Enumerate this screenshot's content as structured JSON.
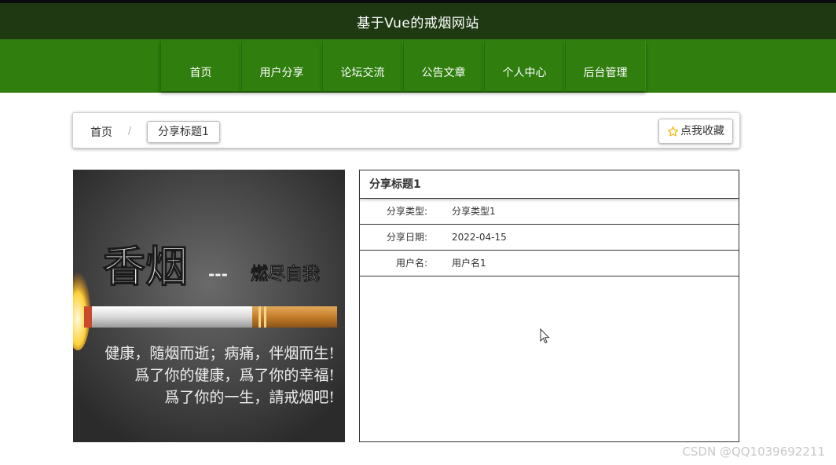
{
  "header": {
    "title": "基于Vue的戒烟网站"
  },
  "nav": {
    "items": [
      {
        "label": "首页"
      },
      {
        "label": "用户分享"
      },
      {
        "label": "论坛交流"
      },
      {
        "label": "公告文章"
      },
      {
        "label": "个人中心"
      },
      {
        "label": "后台管理"
      }
    ]
  },
  "breadcrumb": {
    "home": "首页",
    "separator": "/",
    "current": "分享标题1",
    "favorite_label": "点我收藏"
  },
  "poster": {
    "headline": "香烟",
    "dashes": "---",
    "tagline": "燃尽自我",
    "lines": [
      "健康，隨烟而逝；病痛，伴烟而生!",
      "爲了你的健康，爲了你的幸福!",
      "爲了你的一生，請戒烟吧!"
    ]
  },
  "detail": {
    "title": "分享标题1",
    "rows": [
      {
        "label": "分享类型:",
        "value": "分享类型1"
      },
      {
        "label": "分享日期:",
        "value": "2022-04-15"
      },
      {
        "label": "用户名:",
        "value": "用户名1"
      }
    ]
  },
  "watermark": "CSDN @QQ1039692211",
  "colors": {
    "title_bar": "#1f3a13",
    "nav_bar": "#2f7e0e",
    "star": "#f2b90c"
  }
}
